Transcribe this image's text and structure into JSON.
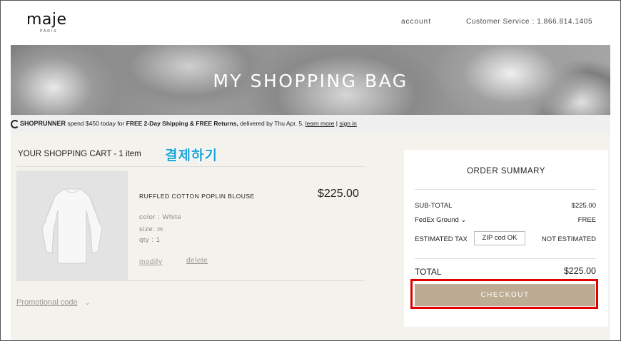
{
  "header": {
    "logo": "maje",
    "logo_sub": "PARIS",
    "account": "account",
    "customer_service": "Customer Service : 1.866.814.1405"
  },
  "hero": {
    "title": "MY SHOPPING BAG"
  },
  "shoprunner": {
    "brand": "SHOPRUNNER",
    "text_before": " spend $450 today for ",
    "bold": "FREE 2-Day Shipping & FREE Returns,",
    "text_after": " delivered by Thu Apr. 5. ",
    "learn_more": "learn more",
    "divider": " | ",
    "sign_in": "sign in"
  },
  "cart": {
    "title": "YOUR SHOPPING CART - 1 item",
    "annotation": "결제하기",
    "item": {
      "name": "RUFFLED COTTON POPLIN BLOUSE",
      "price": "$225.00",
      "color": "color : White",
      "size": "size: m",
      "qty": "qty : 1",
      "modify": "modify",
      "delete": "delete"
    },
    "promo": "Promotional code",
    "promo_chevron": "⌄"
  },
  "summary": {
    "title": "ORDER SUMMARY",
    "subtotal_label": "SUB-TOTAL",
    "subtotal_value": "$225.00",
    "shipping_label": "FedEx Ground",
    "shipping_chevron": "⌄",
    "shipping_value": "FREE",
    "tax_label": "ESTIMATED TAX",
    "zip_value": "ZIP cod OK",
    "tax_value": "NOT ESTIMATED",
    "total_label": "TOTAL",
    "total_value": "$225.00",
    "checkout": "CHECKOUT"
  },
  "colors": {
    "checkout": "#bcac94",
    "highlight": "#e00000",
    "annotation": "#1aa3d6",
    "panel_bg": "#f4f2ec"
  }
}
